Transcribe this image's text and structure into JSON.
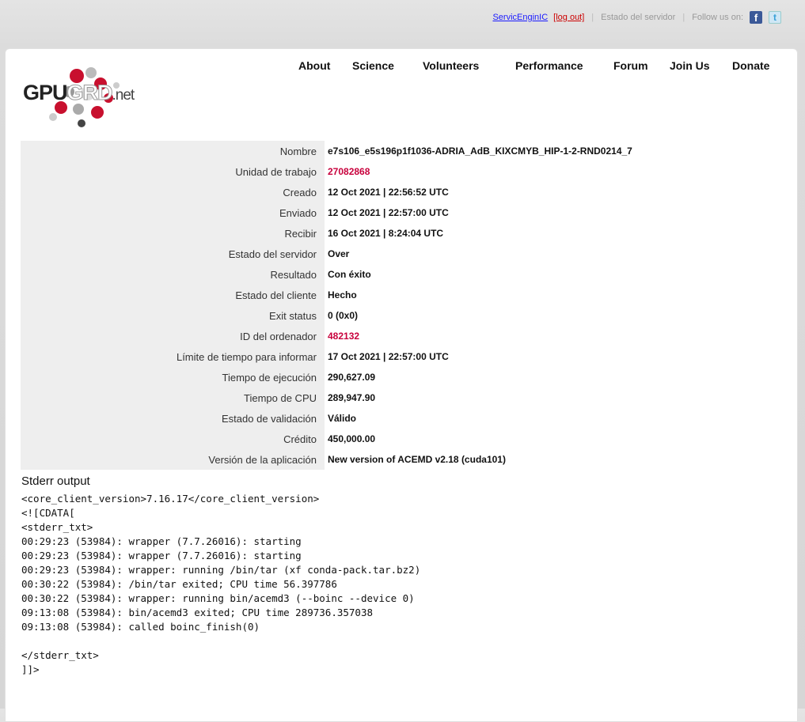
{
  "topbar": {
    "user": "ServicEnginIC",
    "logout": "[log out]",
    "server_status": "Estado del servidor",
    "follow": "Follow us on:",
    "facebook_icon": "facebook-icon",
    "twitter_icon": "twitter-icon"
  },
  "logo": {
    "gpu": "GPU",
    "grd": "GRD",
    "net": ".net"
  },
  "nav": [
    "About",
    "Science",
    "Volunteers",
    "Performance",
    "Forum",
    "Join Us",
    "Donate"
  ],
  "task": [
    {
      "label": "Nombre",
      "value": "e7s106_e5s196p1f1036-ADRIA_AdB_KIXCMYB_HIP-1-2-RND0214_7",
      "link": false
    },
    {
      "label": "Unidad de trabajo",
      "value": "27082868",
      "link": true
    },
    {
      "label": "Creado",
      "value": "12 Oct 2021 | 22:56:52 UTC",
      "link": false
    },
    {
      "label": "Enviado",
      "value": "12 Oct 2021 | 22:57:00 UTC",
      "link": false
    },
    {
      "label": "Recibir",
      "value": "16 Oct 2021 | 8:24:04 UTC",
      "link": false
    },
    {
      "label": "Estado del servidor",
      "value": "Over",
      "link": false
    },
    {
      "label": "Resultado",
      "value": "Con éxito",
      "link": false
    },
    {
      "label": "Estado del cliente",
      "value": "Hecho",
      "link": false
    },
    {
      "label": "Exit status",
      "value": "0 (0x0)",
      "link": false
    },
    {
      "label": "ID del ordenador",
      "value": "482132",
      "link": true
    },
    {
      "label": "Límite de tiempo para informar",
      "value": "17 Oct 2021 | 22:57:00 UTC",
      "link": false
    },
    {
      "label": "Tiempo de ejecución",
      "value": "290,627.09",
      "link": false
    },
    {
      "label": "Tiempo de CPU",
      "value": "289,947.90",
      "link": false
    },
    {
      "label": "Estado de validación",
      "value": "Válido",
      "link": false
    },
    {
      "label": "Crédito",
      "value": "450,000.00",
      "link": false
    },
    {
      "label": "Versión de la aplicación",
      "value": "New version of ACEMD v2.18 (cuda101)",
      "link": false
    }
  ],
  "stderr": {
    "title": "Stderr output",
    "text": "<core_client_version>7.16.17</core_client_version>\n<![CDATA[\n<stderr_txt>\n00:29:23 (53984): wrapper (7.7.26016): starting\n00:29:23 (53984): wrapper (7.7.26016): starting\n00:29:23 (53984): wrapper: running /bin/tar (xf conda-pack.tar.bz2)\n00:30:22 (53984): /bin/tar exited; CPU time 56.397786\n00:30:22 (53984): wrapper: running bin/acemd3 (--boinc --device 0)\n09:13:08 (53984): bin/acemd3 exited; CPU time 289736.357038\n09:13:08 (53984): called boinc_finish(0)\n\n</stderr_txt>\n]]>"
  }
}
